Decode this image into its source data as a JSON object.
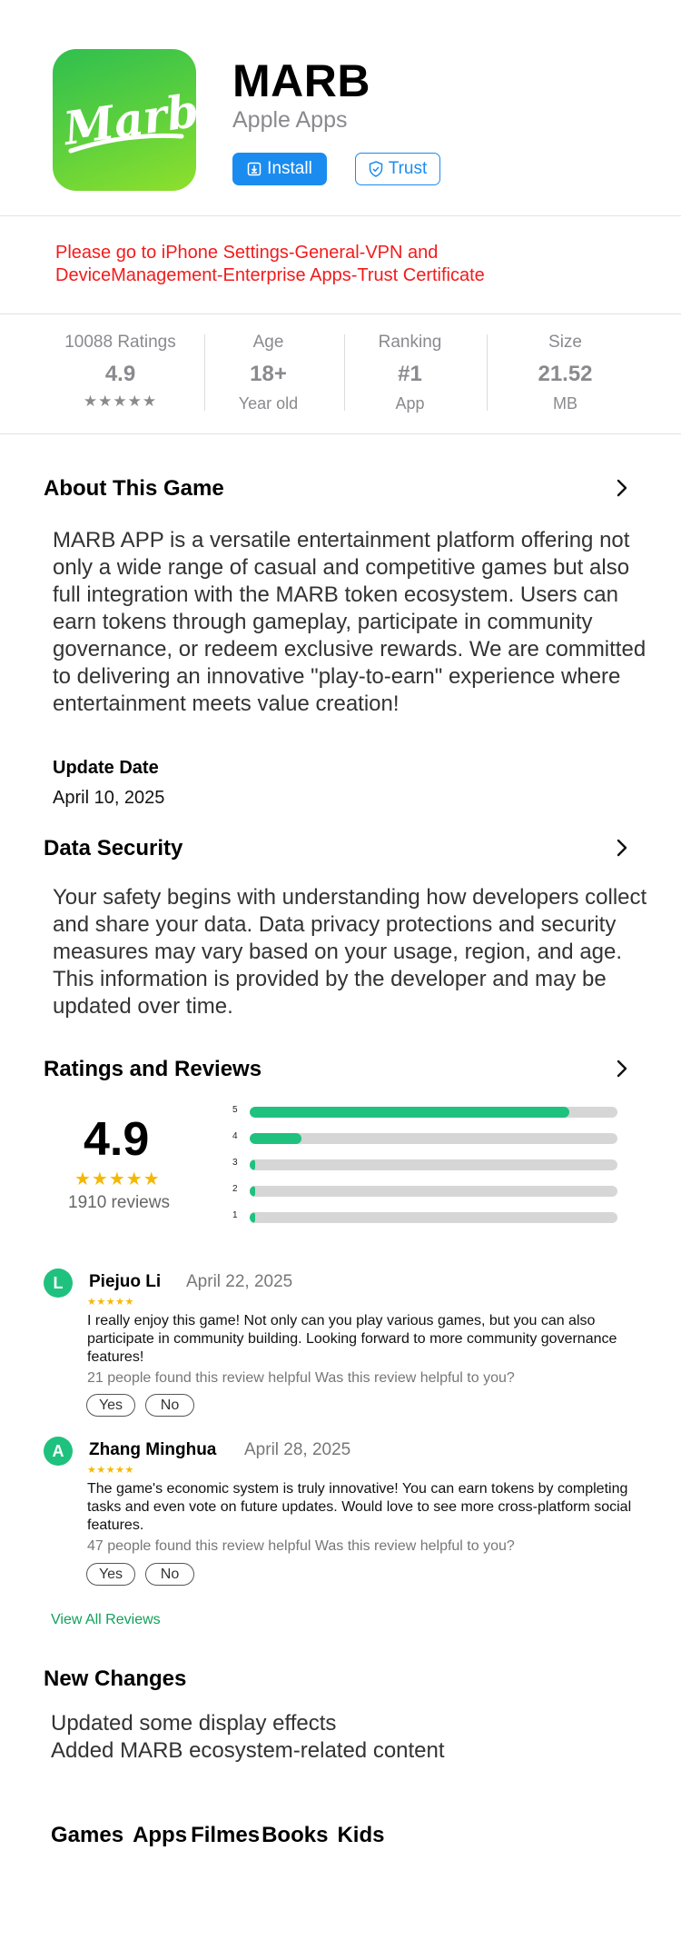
{
  "header": {
    "app_name": "MARB",
    "subtitle": "Apple Apps",
    "icon_text": "Marb",
    "install_label": "Install",
    "trust_label": "Trust"
  },
  "notice": {
    "text_line1": "Please go to iPhone Settings-General-VPN and",
    "text_line2": "DeviceManagement-Enterprise Apps-Trust Certificate",
    "color": "#f31b1b"
  },
  "stats": [
    {
      "label": "10088 Ratings",
      "value": "4.9",
      "sub": "★★★★★"
    },
    {
      "label": "Age",
      "value": "18+",
      "sub": "Year old"
    },
    {
      "label": "Ranking",
      "value": "#1",
      "sub": "App"
    },
    {
      "label": "Size",
      "value": "21.52",
      "sub": "MB"
    }
  ],
  "about": {
    "title": "About This Game",
    "description": "MARB APP is a versatile entertainment platform offering not only a wide range of casual and competitive games but also full integration with the MARB token ecosystem. Users can earn tokens through gameplay, participate in community governance, or redeem exclusive rewards. We are committed to delivering an innovative \"play-to-earn\" experience where entertainment meets value creation!",
    "update_label": "Update Date",
    "update_date": "April 10, 2025"
  },
  "security": {
    "title": "Data Security",
    "description": "Your safety begins with understanding how developers collect and share your data. Data privacy protections and security measures may vary based on your usage, region, and age. This information is provided by the developer and may be updated over time."
  },
  "ratings": {
    "title": "Ratings and Reviews",
    "score": "4.9",
    "stars": "★★★★★",
    "review_count": "1910 reviews",
    "distribution": [
      {
        "stars": "5",
        "fraction": 0.87
      },
      {
        "stars": "4",
        "fraction": 0.14
      },
      {
        "stars": "3",
        "fraction": 0.015
      },
      {
        "stars": "2",
        "fraction": 0.015
      },
      {
        "stars": "1",
        "fraction": 0.015
      }
    ],
    "bar_color": "#1fc17e"
  },
  "reviews": [
    {
      "initial": "L",
      "name": "Piejuo Li",
      "date": "April 22, 2025",
      "stars": "★★★★★",
      "text": "I really enjoy this game! Not only can you play various games, but you can also participate in community building. Looking forward to more community governance features!",
      "helpful": "21 people found this review helpful Was this review helpful to you?",
      "yes": "Yes",
      "no": "No"
    },
    {
      "initial": "A",
      "name": "Zhang Minghua",
      "date": "April 28, 2025",
      "stars": "★★★★★",
      "text": "The game's economic system is truly innovative! You can earn tokens by completing tasks and even vote on future updates. Would love to see more cross-platform social features.",
      "helpful": "47 people found this review helpful Was this review helpful to you?",
      "yes": "Yes",
      "no": "No"
    }
  ],
  "view_all_label": "View All Reviews",
  "changes": {
    "title": "New Changes",
    "line1": "Updated some display effects",
    "line2": "Added MARB ecosystem-related content"
  },
  "bottom_nav": [
    "Games",
    "Apps",
    "Filmes",
    "Books",
    "Kids"
  ]
}
